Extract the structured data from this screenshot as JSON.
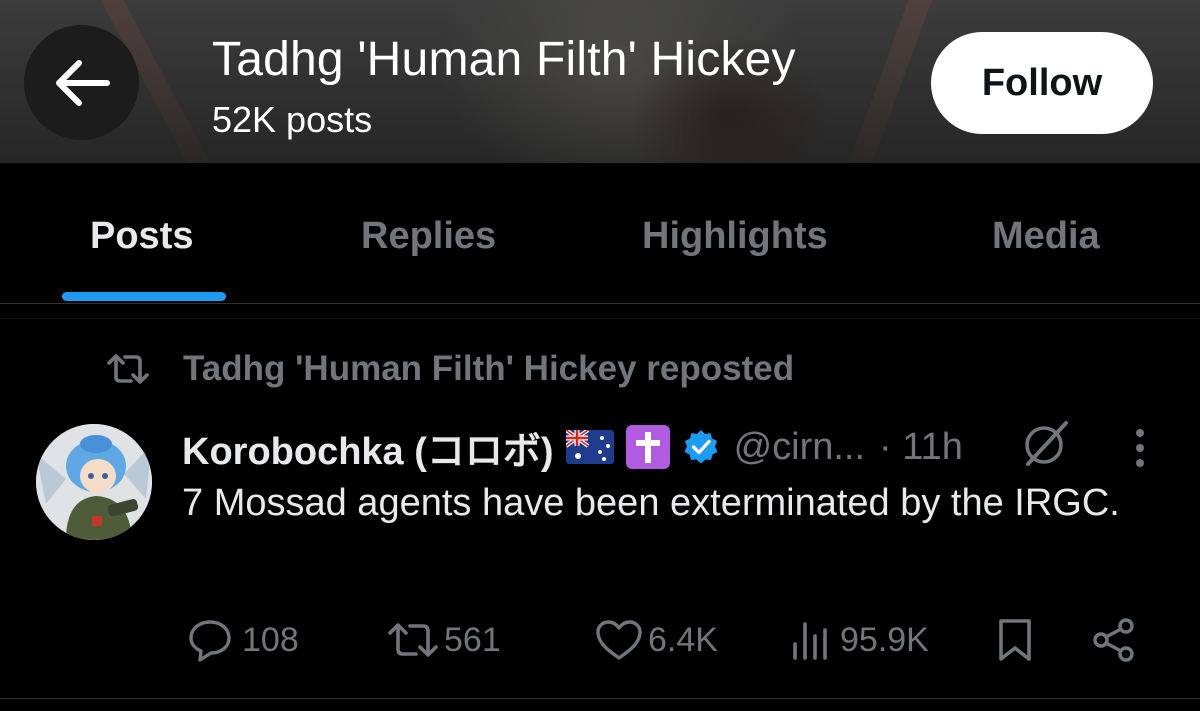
{
  "header": {
    "name": "Tadhg 'Human Filth' Hickey",
    "posts_count": "52K posts",
    "follow_label": "Follow"
  },
  "tabs": [
    {
      "label": "Posts",
      "active": true
    },
    {
      "label": "Replies",
      "active": false
    },
    {
      "label": "Highlights",
      "active": false
    },
    {
      "label": "Media",
      "active": false
    }
  ],
  "post": {
    "repost_label": "Tadhg 'Human Filth' Hickey reposted",
    "author_name": "Korobochka (コロボ)",
    "handle": "@cirn...",
    "time": "· 11h",
    "text": "7 Mossad agents have been exterminated by the IRGC.",
    "stats": {
      "replies": "108",
      "reposts": "561",
      "likes": "6.4K",
      "views": "95.9K"
    }
  },
  "colors": {
    "accent": "#1d9bf0",
    "muted": "#71767b",
    "text": "#e7e9ea",
    "background": "#000000"
  },
  "icons": [
    "back-arrow-icon",
    "repost-icon",
    "verified-badge-icon",
    "grok-icon",
    "more-icon",
    "reply-icon",
    "like-icon",
    "views-icon",
    "bookmark-icon",
    "share-icon"
  ]
}
